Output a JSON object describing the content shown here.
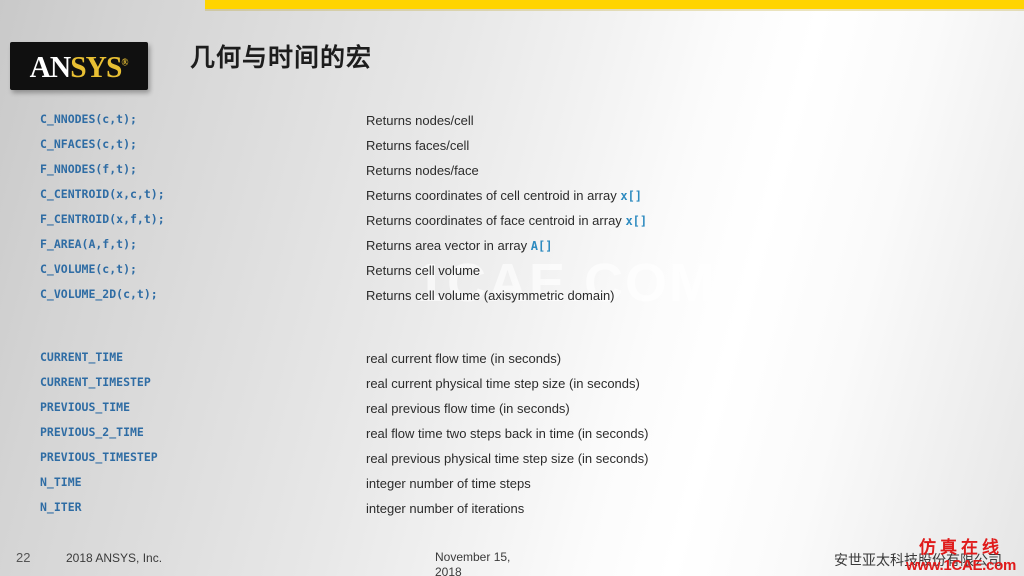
{
  "slide": {
    "title": "几何与时间的宏",
    "accent_color": "#ffd400",
    "code_color": "#2e6ca4",
    "logo": {
      "part1": "AN",
      "part2": "SYS",
      "registered": "®"
    }
  },
  "watermarks": {
    "center_faint": "1CAE.COM",
    "red_cn": "仿真在线",
    "red_url": "www.1CAE.com"
  },
  "geometry_macros": [
    {
      "macro": "C_NNODES(c,t);",
      "desc": "Returns nodes/cell",
      "array": ""
    },
    {
      "macro": "C_NFACES(c,t);",
      "desc": "Returns faces/cell",
      "array": ""
    },
    {
      "macro": "F_NNODES(f,t);",
      "desc": "Returns nodes/face",
      "array": ""
    },
    {
      "macro": "C_CENTROID(x,c,t);",
      "desc": "Returns coordinates of cell centroid in array",
      "array": "x[]"
    },
    {
      "macro": "F_CENTROID(x,f,t);",
      "desc": "Returns coordinates of face centroid in array",
      "array": "x[]"
    },
    {
      "macro": "F_AREA(A,f,t);",
      "desc": "Returns area vector in array",
      "array": "A[]"
    },
    {
      "macro": "C_VOLUME(c,t);",
      "desc": "Returns cell volume",
      "array": ""
    },
    {
      "macro": "C_VOLUME_2D(c,t);",
      "desc": "Returns cell volume (axisymmetric domain)",
      "array": ""
    }
  ],
  "time_macros": [
    {
      "macro": "CURRENT_TIME",
      "desc": "real current flow time (in seconds)",
      "array": ""
    },
    {
      "macro": "CURRENT_TIMESTEP",
      "desc": "real current physical time step size (in seconds)",
      "array": ""
    },
    {
      "macro": "PREVIOUS_TIME",
      "desc": "real previous flow time (in seconds)",
      "array": ""
    },
    {
      "macro": "PREVIOUS_2_TIME",
      "desc": "real flow time two steps back in time (in seconds)",
      "array": ""
    },
    {
      "macro": "PREVIOUS_TIMESTEP",
      "desc": "real previous physical time step size (in seconds)",
      "array": ""
    },
    {
      "macro": "N_TIME",
      "desc": "integer number of time steps",
      "array": ""
    },
    {
      "macro": "N_ITER",
      "desc": "integer number of iterations",
      "array": ""
    }
  ],
  "footer": {
    "page_number": "22",
    "copyright": "2018  ANSYS, Inc.",
    "date": "November 15,",
    "date_year": "2018",
    "company": "安世亚太科技股份有限公司"
  }
}
